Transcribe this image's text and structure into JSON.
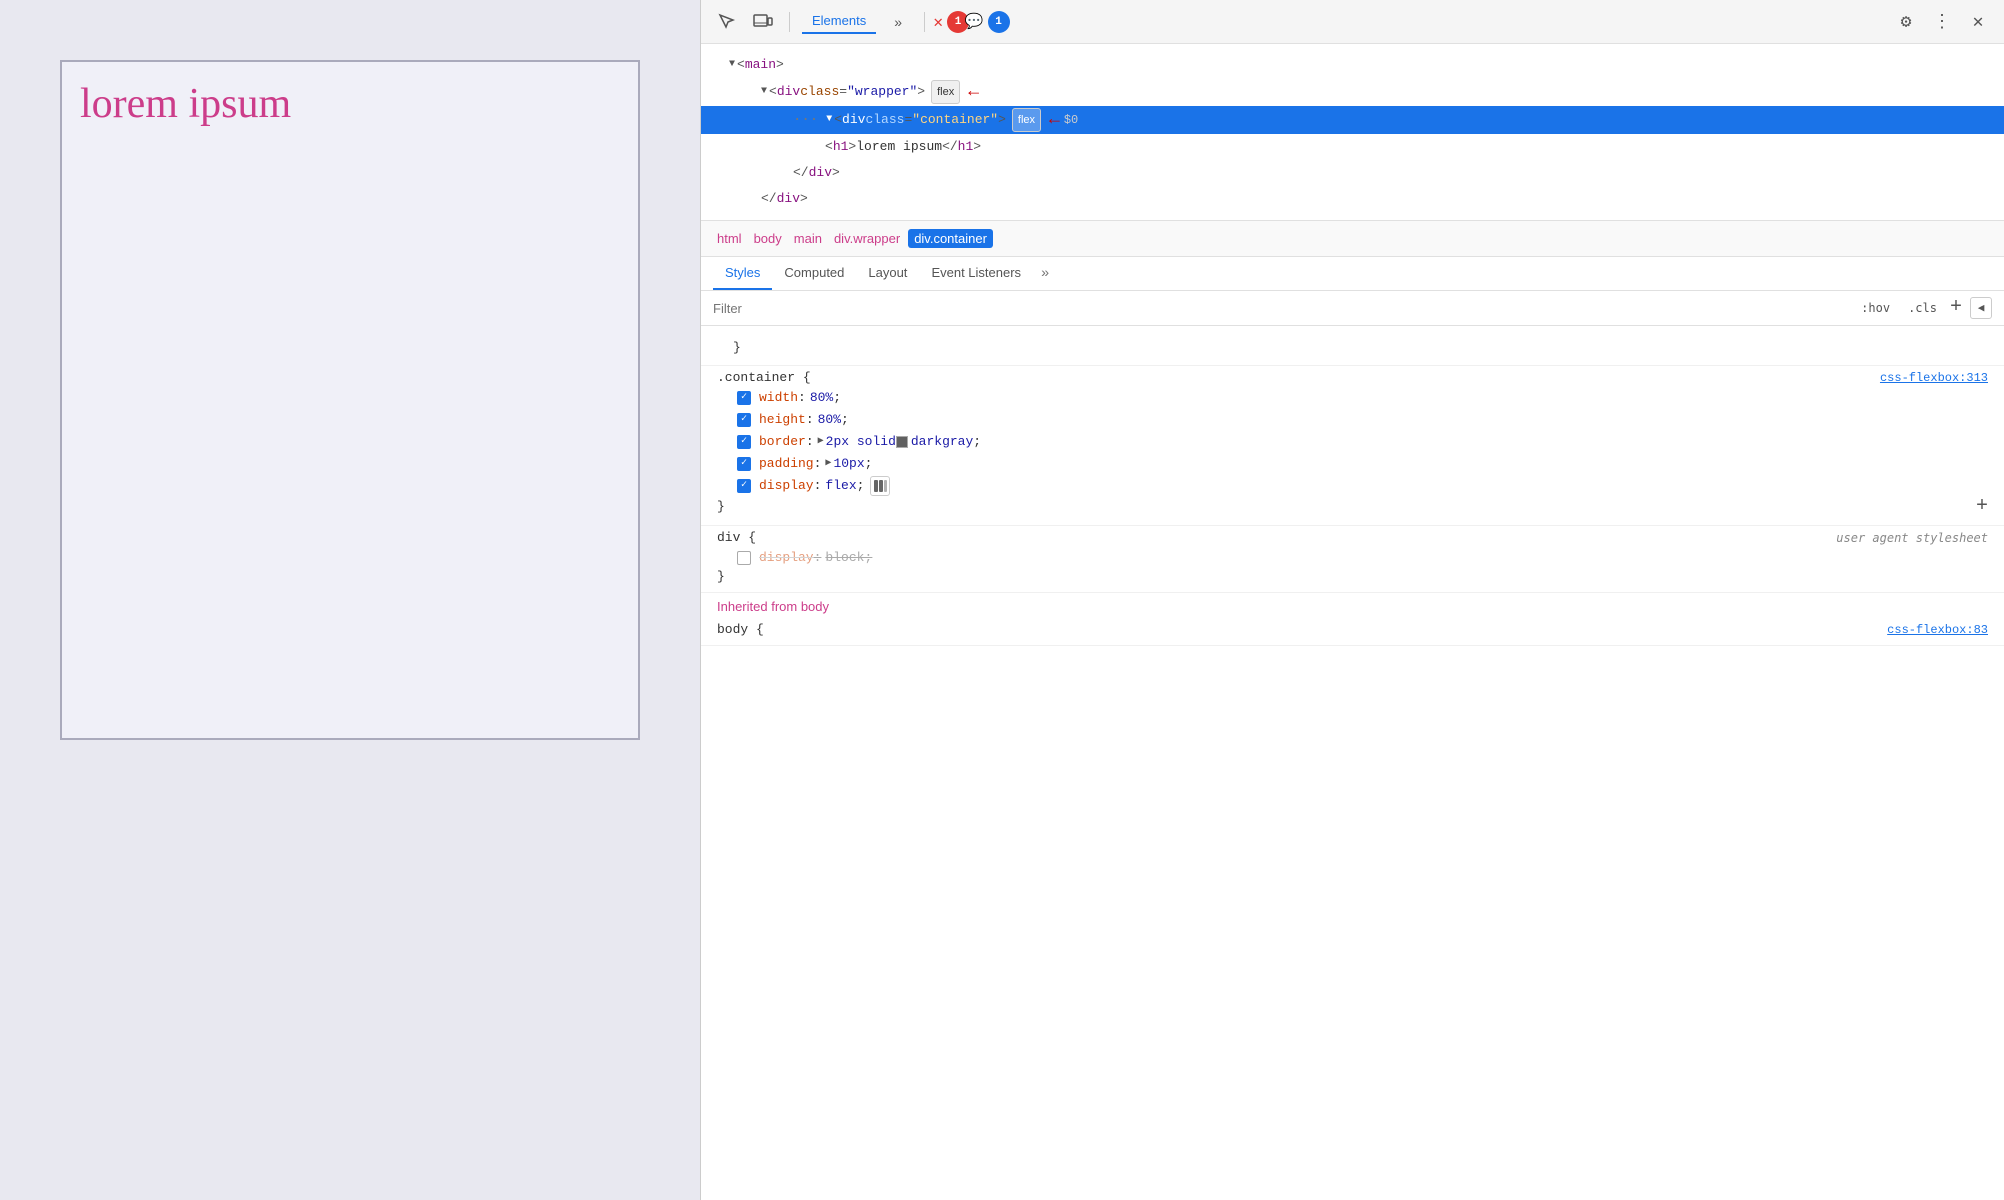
{
  "viewport": {
    "lorem_text": "lorem ipsum"
  },
  "devtools": {
    "toolbar": {
      "inspect_icon": "⊹",
      "device_icon": "▭",
      "elements_tab": "Elements",
      "more_tabs_icon": "»",
      "errors_badge": "1",
      "console_badge": "1",
      "settings_icon": "⚙",
      "more_icon": "⋮",
      "close_icon": "✕"
    },
    "html_tree": {
      "main_tag": "<main>",
      "wrapper_div": "<div class=\"wrapper\">",
      "wrapper_flex": "flex",
      "container_div": "<div class=\"container\">",
      "container_flex": "flex",
      "h1_open": "<h1>lorem ipsum</h1>",
      "div_close": "</div>",
      "main_close": "</div>"
    },
    "breadcrumbs": [
      "html",
      "body",
      "main",
      "div.wrapper",
      "div.container"
    ],
    "styles_tabs": [
      "Styles",
      "Computed",
      "Layout",
      "Event Listeners"
    ],
    "filter": {
      "placeholder": "Filter",
      "hov_btn": ":hov",
      "cls_btn": ".cls",
      "add_btn": "+",
      "toggle_btn": "◀"
    },
    "css_rules": {
      "container_rule": {
        "selector": ".container {",
        "source": "css-flexbox:313",
        "properties": [
          {
            "prop": "width",
            "value": "80%",
            "checked": true,
            "strikethrough": false
          },
          {
            "prop": "height",
            "value": "80%",
            "checked": true,
            "strikethrough": false
          },
          {
            "prop": "border",
            "value": "2px solid",
            "color": "darkgray",
            "checked": true,
            "strikethrough": false,
            "has_color": true
          },
          {
            "prop": "padding",
            "value": "10px",
            "checked": true,
            "strikethrough": false,
            "has_triangle": true
          },
          {
            "prop": "display",
            "value": "flex",
            "checked": true,
            "strikethrough": false,
            "has_flex_icon": true
          }
        ]
      },
      "div_rule": {
        "selector": "div {",
        "source": "user agent stylesheet",
        "properties": [
          {
            "prop": "display",
            "value": "block",
            "checked": false,
            "strikethrough": true
          }
        ]
      }
    },
    "inherited_label": "Inherited from",
    "inherited_element": "body",
    "inherited_source": "css-flexbox:83",
    "body_rule_partial": "body {"
  }
}
